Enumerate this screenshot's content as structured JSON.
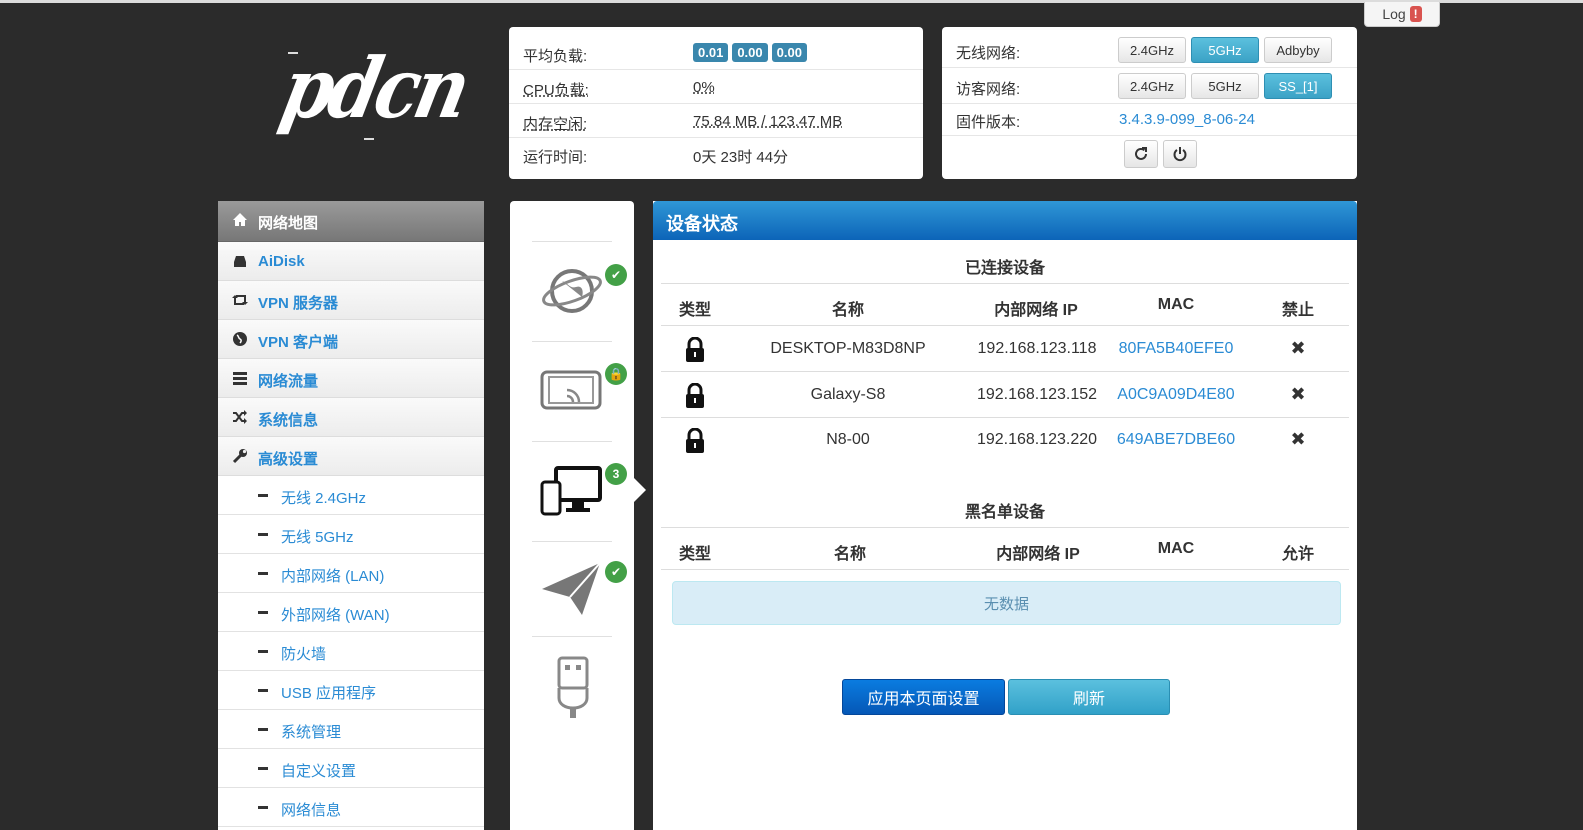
{
  "header": {
    "log_label": "Log",
    "log_alert": "!",
    "logo_text": "pdcn"
  },
  "sysinfo": {
    "load_label": "平均负载:",
    "load_values": [
      "0.01",
      "0.00",
      "0.00"
    ],
    "cpu_label": "CPU负载:",
    "cpu_value": "0%",
    "mem_label": "内存空闲:",
    "mem_value": "75.84 MB / 123.47 MB",
    "uptime_label": "运行时间:",
    "uptime_value": "0天 23时 44分"
  },
  "wireless": {
    "wifi_label": "无线网络:",
    "wifi_buttons": [
      "2.4GHz",
      "5GHz",
      "Adbyby"
    ],
    "guest_label": "访客网络:",
    "guest_buttons": [
      "2.4GHz",
      "5GHz",
      "SS_[1]"
    ],
    "fw_label": "固件版本:",
    "fw_value": "3.4.3.9-099_8-06-24",
    "active_color": "#4bb1d8"
  },
  "nav": {
    "items": [
      {
        "label": "网络地图",
        "icon": "home-icon"
      },
      {
        "label": "AiDisk",
        "icon": "disk-icon"
      },
      {
        "label": "VPN 服务器",
        "icon": "retweet-icon"
      },
      {
        "label": "VPN 客户端",
        "icon": "globe-icon"
      },
      {
        "label": "网络流量",
        "icon": "tasks-icon"
      },
      {
        "label": "系统信息",
        "icon": "random-icon"
      },
      {
        "label": "高级设置",
        "icon": "wrench-icon"
      }
    ],
    "sub_items": [
      "无线 2.4GHz",
      "无线 5GHz",
      "内部网络 (LAN)",
      "外部网络 (WAN)",
      "防火墙",
      "USB 应用程序",
      "系统管理",
      "自定义设置",
      "网络信息"
    ]
  },
  "status_icons": {
    "clients_count": "3"
  },
  "main": {
    "title": "设备状态",
    "connected_title": "已连接设备",
    "connected_headers": [
      "类型",
      "名称",
      "内部网络 IP",
      "MAC",
      "禁止"
    ],
    "devices": [
      {
        "name": "DESKTOP-M83D8NP",
        "ip": "192.168.123.118",
        "mac": "80FA5B40EFE0"
      },
      {
        "name": "Galaxy-S8",
        "ip": "192.168.123.152",
        "mac": "A0C9A09D4E80"
      },
      {
        "name": "N8-00",
        "ip": "192.168.123.220",
        "mac": "649ABE7DBE60"
      }
    ],
    "blacklist_title": "黑名单设备",
    "blacklist_headers": [
      "类型",
      "名称",
      "内部网络 IP",
      "MAC",
      "允许"
    ],
    "empty_text": "无数据",
    "apply_label": "应用本页面设置",
    "refresh_label": "刷新"
  }
}
